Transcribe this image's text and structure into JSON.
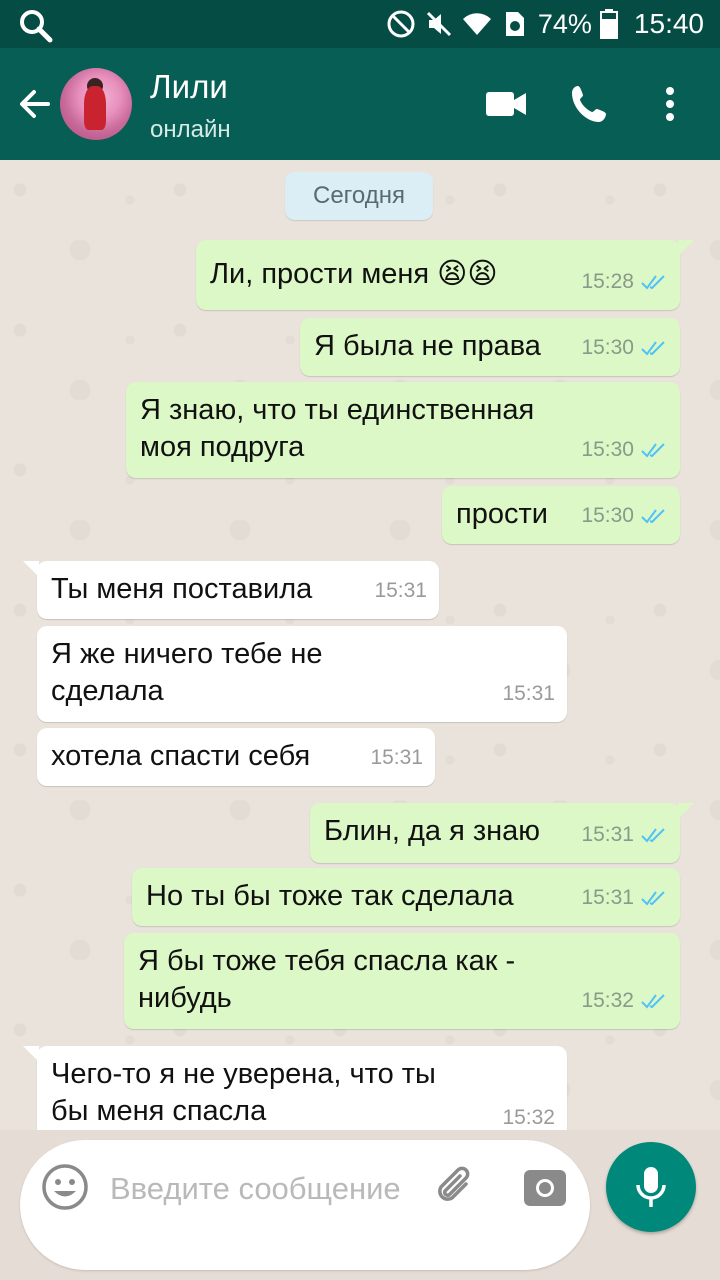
{
  "status_bar": {
    "battery": "74%",
    "time": "15:40"
  },
  "header": {
    "contact_name": "Лили",
    "contact_status": "онлайн"
  },
  "chat": {
    "date_label": "Сегодня",
    "messages": [
      {
        "dir": "out",
        "text": "Ли, прости меня 😫😫",
        "time": "15:28"
      },
      {
        "dir": "out",
        "text": "Я была не права",
        "time": "15:30"
      },
      {
        "dir": "out",
        "text": "Я знаю, что ты единственная моя подруга",
        "time": "15:30"
      },
      {
        "dir": "out",
        "text": "прости",
        "time": "15:30"
      },
      {
        "dir": "in",
        "text": "Ты меня поставила",
        "time": "15:31"
      },
      {
        "dir": "in",
        "text": "Я же ничего тебе не сделала",
        "time": "15:31"
      },
      {
        "dir": "in",
        "text": "хотела спасти себя",
        "time": "15:31"
      },
      {
        "dir": "out",
        "text": "Блин, да я знаю",
        "time": "15:31"
      },
      {
        "dir": "out",
        "text": "Но ты бы тоже так сделала",
        "time": "15:31"
      },
      {
        "dir": "out",
        "text": "Я бы тоже тебя спасла как - нибудь",
        "time": "15:32"
      },
      {
        "dir": "in",
        "text": "Чего-то я не уверена, что ты бы меня спасла",
        "time": "15:32"
      }
    ]
  },
  "input": {
    "placeholder": "Введите сообщение"
  },
  "colors": {
    "header": "#075e54",
    "status_bar": "#054d44",
    "outgoing_bubble": "#dcf8c6",
    "incoming_bubble": "#ffffff",
    "read_ticks": "#4fc3f7",
    "mic_button": "#00897b"
  },
  "icons": [
    "search-icon",
    "dnd-icon",
    "mute-icon",
    "wifi-icon",
    "sim-icon",
    "battery-icon",
    "back-arrow-icon",
    "video-call-icon",
    "phone-icon",
    "more-icon",
    "read-ticks-icon",
    "emoji-icon",
    "attach-icon",
    "camera-icon",
    "mic-icon"
  ]
}
